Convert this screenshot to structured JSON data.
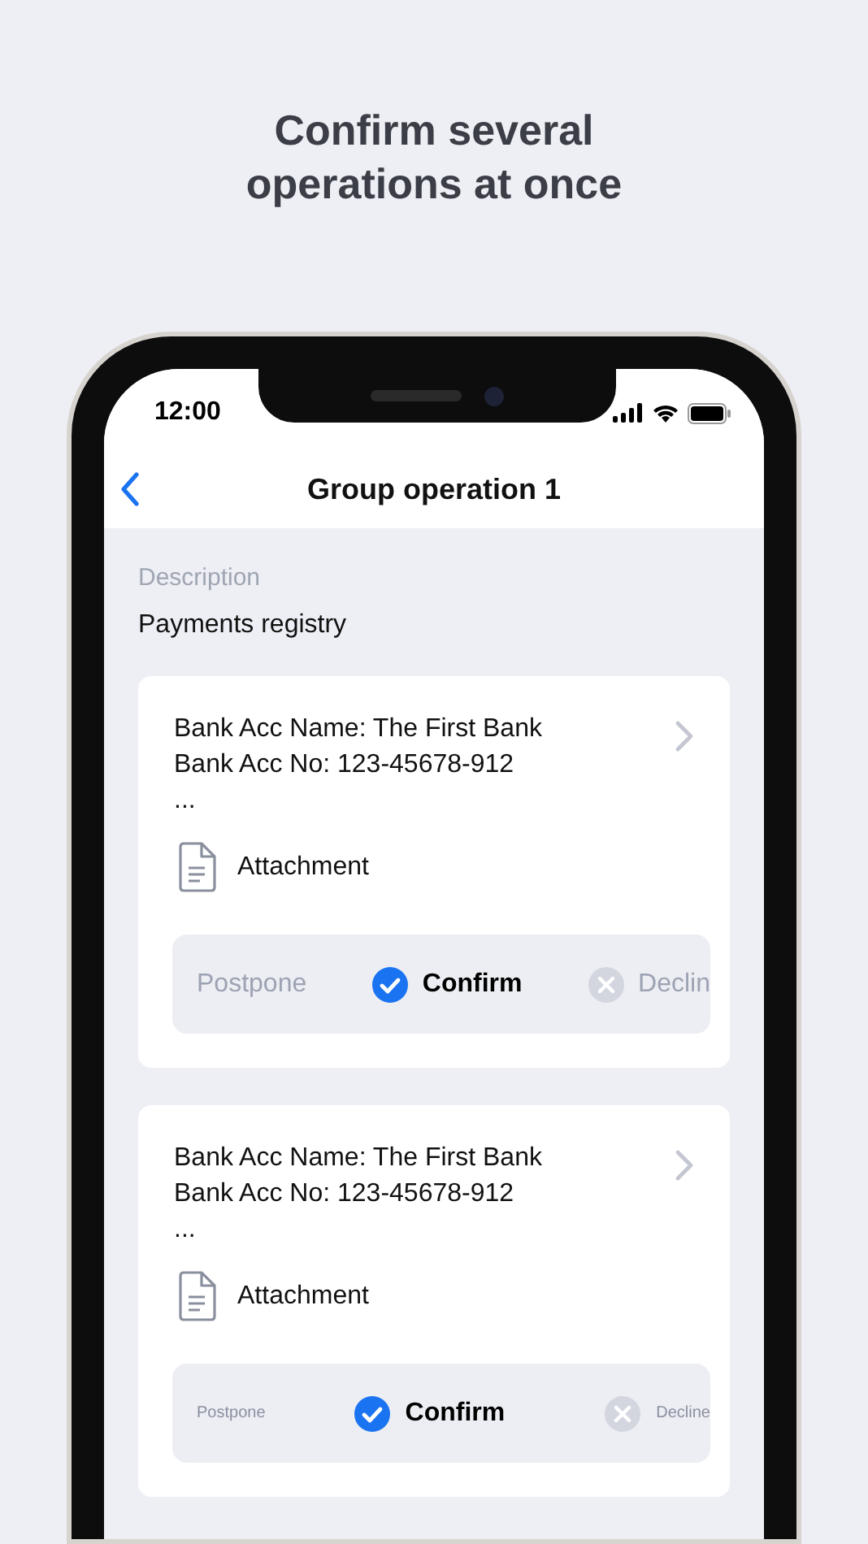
{
  "headline": "Confirm several operations at once",
  "status_bar": {
    "time": "12:00"
  },
  "nav": {
    "title": "Group operation 1"
  },
  "description": {
    "label": "Description",
    "value": "Payments registry"
  },
  "cards": [
    {
      "lines": [
        "Bank Acc Name: The First Bank",
        "Bank Acc No: 123-45678-912",
        "..."
      ],
      "attachment": "Attachment",
      "switcher": {
        "kind": "static",
        "options": [
          {
            "label": "Postpone",
            "kind": "postpone",
            "selected": false
          },
          {
            "label": "Confirm",
            "kind": "confirm",
            "selected": true
          },
          {
            "label": "Declin",
            "kind": "decline",
            "selected": false
          }
        ]
      }
    },
    {
      "lines": [
        "Bank Acc Name: The First Bank",
        "Bank Acc No: 123-45678-912",
        "..."
      ],
      "attachment": "Attachment",
      "switcher": {
        "kind": "sliding",
        "options": [
          {
            "label": "Postpone",
            "kind": "postpone",
            "selected": false
          },
          {
            "label": "Confirm",
            "kind": "confirm",
            "selected": true
          },
          {
            "label": "Decline",
            "kind": "decline",
            "selected": false
          }
        ]
      }
    }
  ]
}
